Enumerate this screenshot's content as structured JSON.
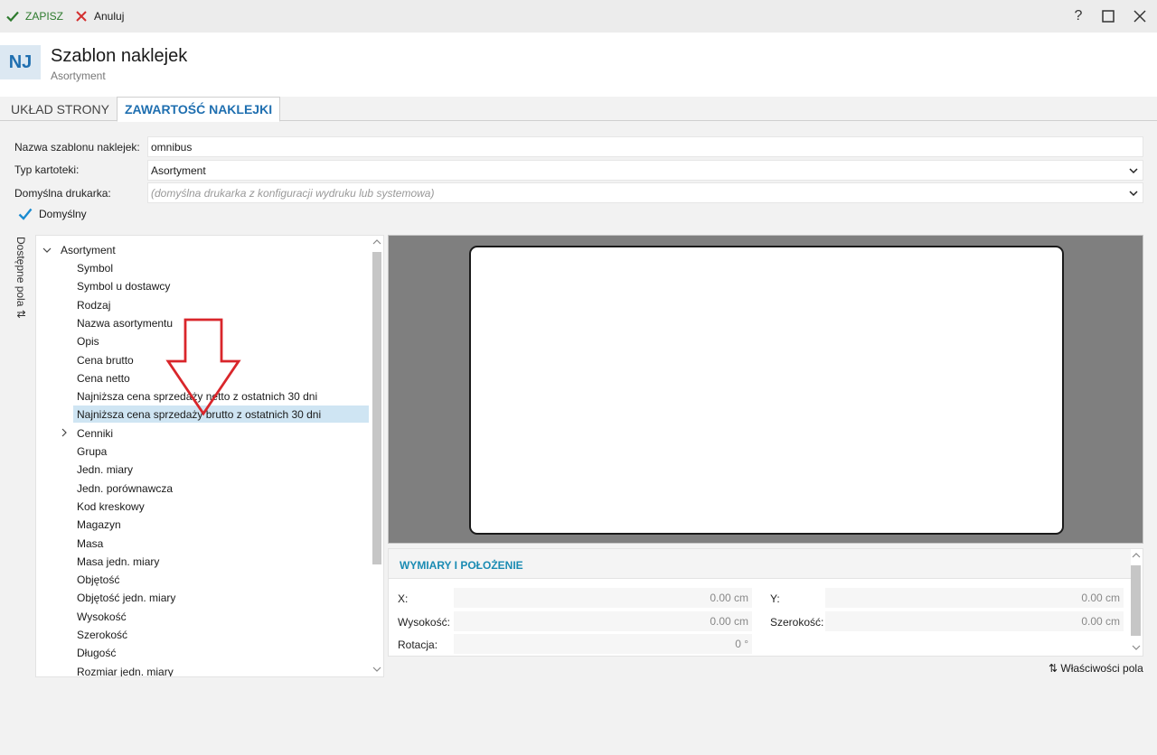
{
  "toolbar": {
    "save_label": "ZAPISZ",
    "cancel_label": "Anuluj",
    "help_glyph": "?",
    "maximize_glyph": "☐",
    "close_glyph": "✕"
  },
  "header": {
    "badge": "NJ",
    "title": "Szablon naklejek",
    "subtitle": "Asortyment"
  },
  "tabs": [
    {
      "label": "UKŁAD STRONY",
      "active": false
    },
    {
      "label": "ZAWARTOŚĆ NAKLEJKI",
      "active": true
    }
  ],
  "form": {
    "name_label": "Nazwa szablonu naklejek:",
    "name_value": "omnibus",
    "type_label": "Typ kartoteki:",
    "type_value": "Asortyment",
    "printer_label": "Domyślna drukarka:",
    "printer_placeholder": "(domyślna drukarka z konfiguracji wydruku lub systemowa)",
    "default_label": "Domyślny",
    "default_checked": true
  },
  "side_label": "Dostępne pola ⇅",
  "tree": {
    "root": "Asortyment",
    "items": [
      "Symbol",
      "Symbol u dostawcy",
      "Rodzaj",
      "Nazwa asortymentu",
      "Opis",
      "Cena brutto",
      "Cena netto",
      "Najniższa cena sprzedaży netto z ostatnich 30 dni",
      "Najniższa cena sprzedaży brutto z ostatnich 30 dni",
      "Cenniki",
      "Grupa",
      "Jedn. miary",
      "Jedn. porównawcza",
      "Kod kreskowy",
      "Magazyn",
      "Masa",
      "Masa jedn. miary",
      "Objętość",
      "Objętość jedn. miary",
      "Wysokość",
      "Szerokość",
      "Długość",
      "Rozmiar jedn. miary"
    ],
    "selected_index": 8,
    "expandable_index": 9
  },
  "props": {
    "title": "WYMIARY I POŁOŻENIE",
    "x_label": "X:",
    "x_value": "0.00 cm",
    "y_label": "Y:",
    "y_value": "0.00 cm",
    "height_label": "Wysokość:",
    "height_value": "0.00 cm",
    "width_label": "Szerokość:",
    "width_value": "0.00 cm",
    "rotation_label": "Rotacja:",
    "rotation_value": "0 °"
  },
  "field_props_label": "⇅ Właściwości pola",
  "colors": {
    "accent": "#1f6fb0",
    "save_green": "#2d7a2d",
    "cancel_red": "#d32f2f",
    "arrow_red": "#d9262b",
    "selected_row": "#cfe5f3",
    "preview_bg": "#7f7f7f"
  }
}
